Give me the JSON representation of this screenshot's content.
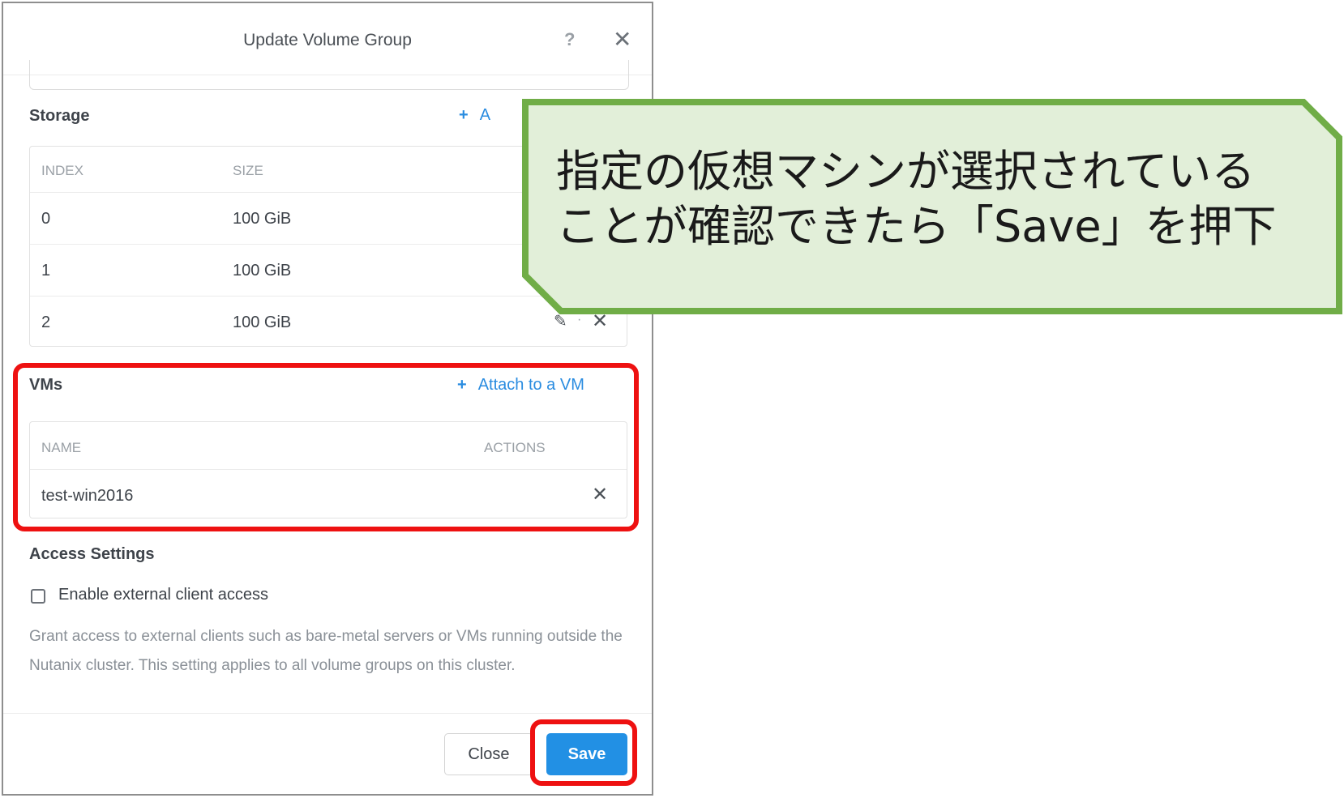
{
  "dialog": {
    "title": "Update Volume Group",
    "help_icon": "?",
    "close_icon": "✕"
  },
  "storage": {
    "title": "Storage",
    "add_link_plus": "+",
    "add_link_label": "A",
    "columns": [
      "INDEX",
      "SIZE"
    ],
    "rows": [
      {
        "index": "0",
        "size": "100 GiB"
      },
      {
        "index": "1",
        "size": "100 GiB"
      },
      {
        "index": "2",
        "size": "100 GiB"
      }
    ],
    "row_action_edit_icon": "pencil-icon",
    "row_action_delete_icon": "close-icon"
  },
  "vms": {
    "title": "VMs",
    "attach_plus": "+",
    "attach_label": "Attach to a VM",
    "columns": [
      "NAME",
      "ACTIONS"
    ],
    "rows": [
      {
        "name": "test-win2016"
      }
    ]
  },
  "access": {
    "title": "Access Settings",
    "checkbox_label": "Enable external client access",
    "checkbox_checked": false,
    "description": "Grant access to external clients such as bare-metal servers or VMs running outside the Nutanix cluster. This setting applies to all volume groups on this cluster."
  },
  "footer": {
    "close_label": "Close",
    "save_label": "Save"
  },
  "annotation": {
    "line1": "指定の仮想マシンが選択されている",
    "line2": "ことが確認できたら「Save」を押下"
  },
  "colors": {
    "accent_blue": "#2290e4",
    "highlight_red": "#ee1111",
    "callout_fill": "#e2efd9",
    "callout_border": "#70ad47"
  }
}
